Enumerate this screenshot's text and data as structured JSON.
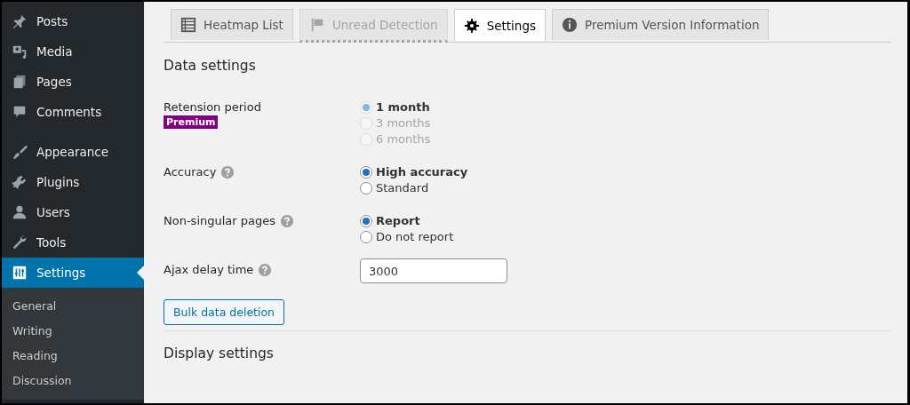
{
  "sidebar": {
    "items": [
      {
        "label": "Posts",
        "selected": false
      },
      {
        "label": "Media",
        "selected": false
      },
      {
        "label": "Pages",
        "selected": false
      },
      {
        "label": "Comments",
        "selected": false
      },
      {
        "label": "Appearance",
        "selected": false
      },
      {
        "label": "Plugins",
        "selected": false
      },
      {
        "label": "Users",
        "selected": false
      },
      {
        "label": "Tools",
        "selected": false
      },
      {
        "label": "Settings",
        "selected": true
      }
    ],
    "submenu": [
      "General",
      "Writing",
      "Reading",
      "Discussion"
    ]
  },
  "tabs": [
    {
      "label": "Heatmap List",
      "selected": false,
      "disabled": false
    },
    {
      "label": "Unread Detection",
      "selected": false,
      "disabled": true
    },
    {
      "label": "Settings",
      "selected": true,
      "disabled": false
    },
    {
      "label": "Premium Version Information",
      "selected": false,
      "disabled": false
    }
  ],
  "sections": [
    {
      "heading": "Data settings",
      "rows": [
        {
          "kind": "radio",
          "label": "Retension period",
          "badge": "Premium",
          "help": false,
          "options": [
            {
              "label": "1 month",
              "selected": true,
              "disabled": true
            },
            {
              "label": "3 months",
              "selected": false,
              "disabled": true
            },
            {
              "label": "6 months",
              "selected": false,
              "disabled": true
            }
          ]
        },
        {
          "kind": "radio",
          "label": "Accuracy",
          "help": true,
          "options": [
            {
              "label": "High accuracy",
              "selected": true,
              "disabled": false
            },
            {
              "label": "Standard",
              "selected": false,
              "disabled": false
            }
          ]
        },
        {
          "kind": "radio",
          "label": "Non-singular pages",
          "help": true,
          "options": [
            {
              "label": "Report",
              "selected": true,
              "disabled": false
            },
            {
              "label": "Do not report",
              "selected": false,
              "disabled": false
            }
          ]
        },
        {
          "kind": "text",
          "label": "Ajax delay time",
          "help": true,
          "value": "3000"
        }
      ],
      "button": "Bulk data deletion"
    },
    {
      "heading": "Display settings"
    }
  ]
}
